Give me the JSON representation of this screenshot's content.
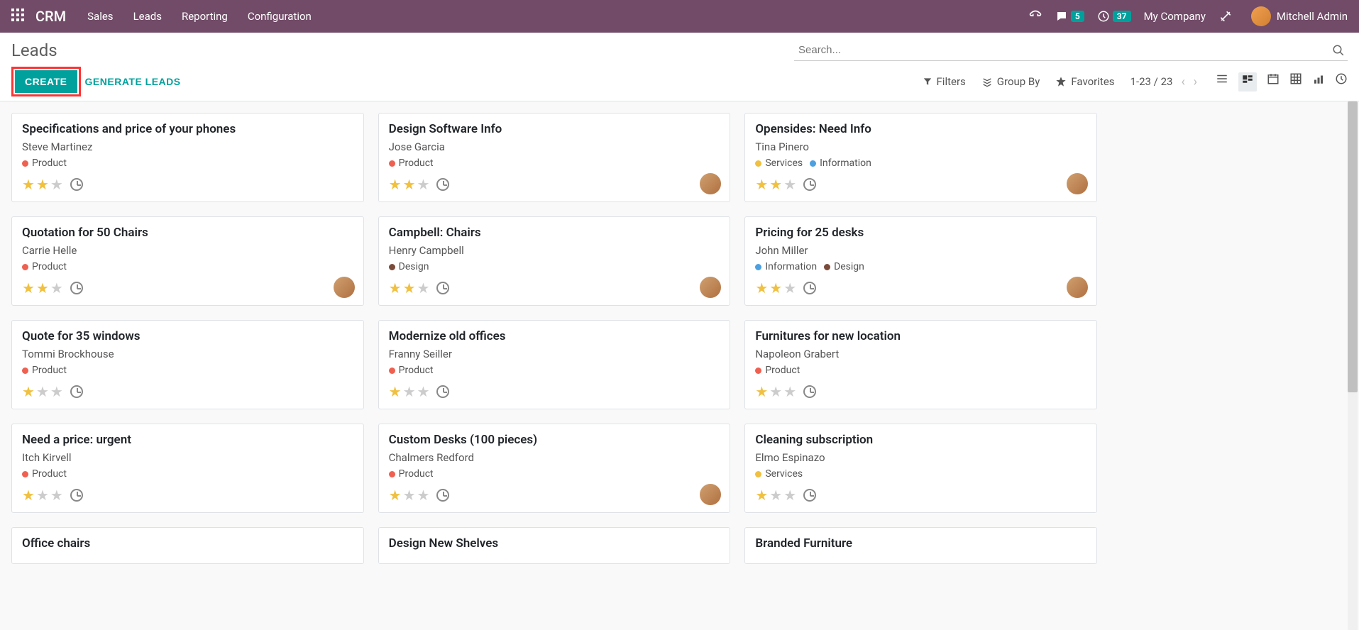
{
  "nav": {
    "brand": "CRM",
    "menus": [
      "Sales",
      "Leads",
      "Reporting",
      "Configuration"
    ],
    "msg_badge": "5",
    "activity_badge": "37",
    "company": "My Company",
    "user": "Mitchell Admin"
  },
  "cp": {
    "breadcrumb": "Leads",
    "search_placeholder": "Search...",
    "create": "CREATE",
    "generate": "GENERATE LEADS",
    "filters": "Filters",
    "groupby": "Group By",
    "favorites": "Favorites",
    "pager": "1-23 / 23"
  },
  "tag_colors": {
    "Product": "red",
    "Services": "yellow",
    "Information": "blue",
    "Design": "brown"
  },
  "cards": [
    {
      "title": "Specifications and price of your phones",
      "contact": "Steve Martinez",
      "tags": [
        "Product"
      ],
      "stars": 2,
      "avatar": false
    },
    {
      "title": "Design Software Info",
      "contact": "Jose Garcia",
      "tags": [
        "Product"
      ],
      "stars": 2,
      "avatar": true
    },
    {
      "title": "Opensides: Need Info",
      "contact": "Tina Pinero",
      "tags": [
        "Services",
        "Information"
      ],
      "stars": 2,
      "avatar": true
    },
    {
      "title": "Quotation for 50 Chairs",
      "contact": "Carrie Helle",
      "tags": [
        "Product"
      ],
      "stars": 2,
      "avatar": true
    },
    {
      "title": "Campbell: Chairs",
      "contact": "Henry Campbell",
      "tags": [
        "Design"
      ],
      "stars": 2,
      "avatar": true
    },
    {
      "title": "Pricing for 25 desks",
      "contact": "John Miller",
      "tags": [
        "Information",
        "Design"
      ],
      "stars": 2,
      "avatar": true
    },
    {
      "title": "Quote for 35 windows",
      "contact": "Tommi Brockhouse",
      "tags": [
        "Product"
      ],
      "stars": 1,
      "avatar": false
    },
    {
      "title": "Modernize old offices",
      "contact": "Franny Seiller",
      "tags": [
        "Product"
      ],
      "stars": 1,
      "avatar": false
    },
    {
      "title": "Furnitures for new location",
      "contact": "Napoleon Grabert",
      "tags": [
        "Product"
      ],
      "stars": 1,
      "avatar": false
    },
    {
      "title": "Need a price: urgent",
      "contact": "Itch Kirvell",
      "tags": [
        "Product"
      ],
      "stars": 1,
      "avatar": false
    },
    {
      "title": "Custom Desks (100 pieces)",
      "contact": "Chalmers Redford",
      "tags": [
        "Product"
      ],
      "stars": 1,
      "avatar": true
    },
    {
      "title": "Cleaning subscription",
      "contact": "Elmo Espinazo",
      "tags": [
        "Services"
      ],
      "stars": 1,
      "avatar": false
    },
    {
      "title": "Office chairs",
      "contact": "",
      "tags": [],
      "stars": 0,
      "avatar": false,
      "partial": true
    },
    {
      "title": "Design New Shelves",
      "contact": "",
      "tags": [],
      "stars": 0,
      "avatar": false,
      "partial": true
    },
    {
      "title": "Branded Furniture",
      "contact": "",
      "tags": [],
      "stars": 0,
      "avatar": false,
      "partial": true
    }
  ]
}
